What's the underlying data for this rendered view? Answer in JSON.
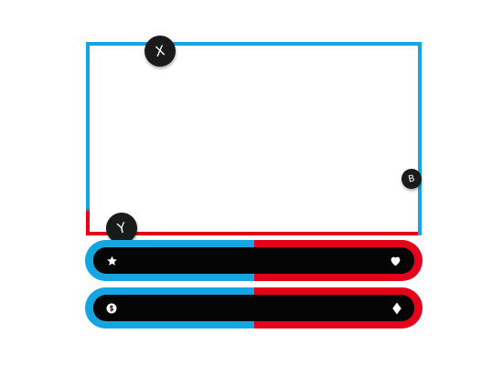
{
  "controller": {
    "colors": {
      "left_accent": "#14a6e0",
      "right_accent": "#e4001b",
      "bar_inner": "#050505",
      "badge_fill": "#1a1a1a",
      "badge_text": "#ffffff"
    },
    "buttons": {
      "x_label": "X",
      "b_label": "B",
      "y_label": "Y"
    },
    "bars": [
      {
        "left_icon": "star-icon",
        "right_icon": "heart-icon"
      },
      {
        "left_icon": "coin-icon",
        "right_icon": "diamond-icon"
      }
    ]
  }
}
